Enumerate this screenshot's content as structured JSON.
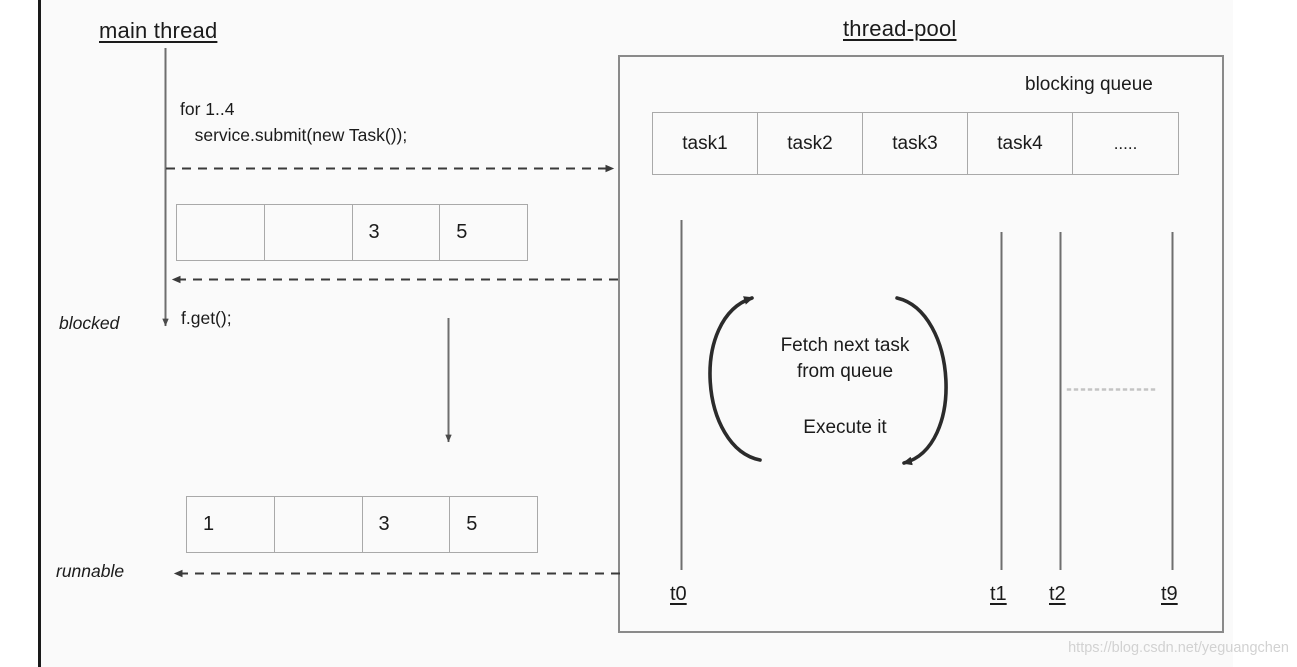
{
  "diagram": {
    "title_main_thread": "main thread",
    "title_thread_pool": "thread-pool",
    "watermark": "https://blog.csdn.net/yeguangchen"
  },
  "main_thread": {
    "code_submit": "for 1..4\n   service.submit(new Task());",
    "code_get": "f.get();",
    "state_blocked": "blocked",
    "state_runnable": "runnable",
    "array_blocked": [
      "",
      "",
      "3",
      "5"
    ],
    "array_runnable": [
      "1",
      "",
      "3",
      "5"
    ]
  },
  "thread_pool": {
    "blocking_queue_label": "blocking queue",
    "queue_cells": [
      "task1",
      "task2",
      "task3",
      "task4",
      "....."
    ],
    "loop_text_top": "Fetch next task\nfrom queue",
    "loop_text_bottom": "Execute it",
    "thread_labels": [
      "t0",
      "t1",
      "t2",
      "t9"
    ]
  },
  "colors": {
    "page_bg": "#fafafa",
    "ink": "#1b1b1b",
    "box_border": "#a9a9a9",
    "frame_border": "#8a8a8a",
    "watermark": "#d2d2d2"
  }
}
